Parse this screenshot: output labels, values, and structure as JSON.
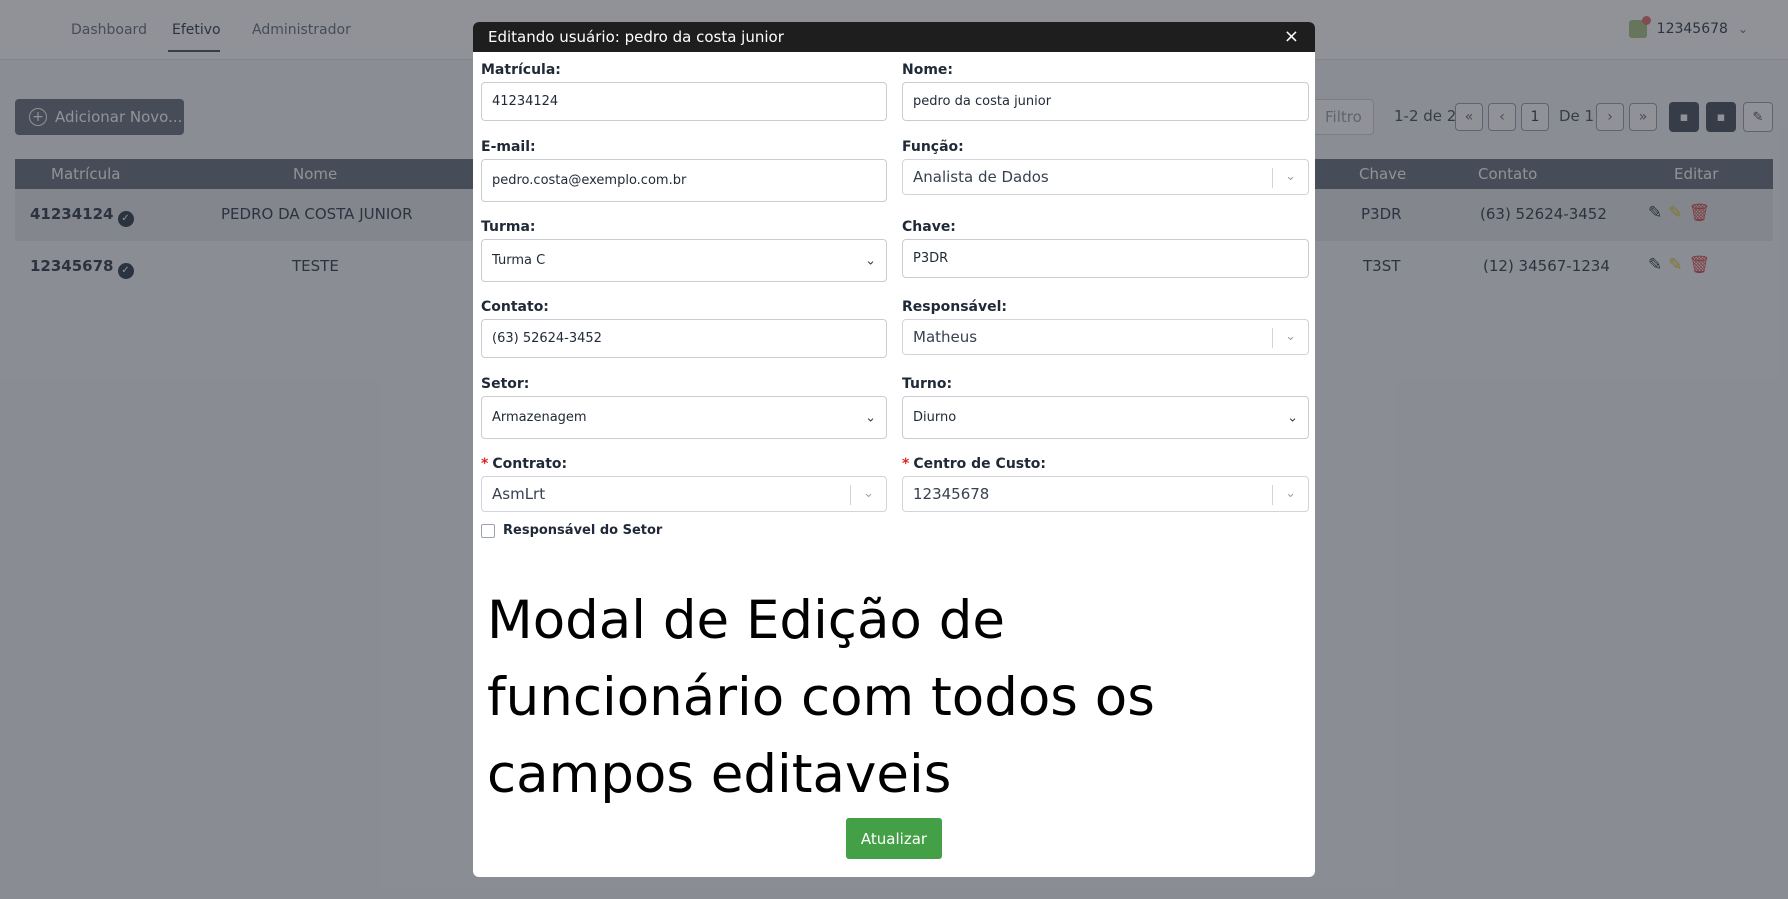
{
  "nav": {
    "items": [
      "Dashboard",
      "Efetivo",
      "Administrador"
    ],
    "user_id": "12345678"
  },
  "toolbar": {
    "add_label": "Adicionar Novo...",
    "filter_label": "Filtro",
    "range_text": "1-2 de 2",
    "current_page": "1",
    "page_of": "De 1"
  },
  "table": {
    "headers": [
      "Matrícula",
      "Nome",
      "Chave",
      "Contato",
      "Editar"
    ],
    "rows": [
      {
        "matricula": "41234124",
        "nome": "PEDRO DA COSTA JUNIOR",
        "chave": "P3DR",
        "contato": "(63) 52624-3452"
      },
      {
        "matricula": "12345678",
        "nome": "TESTE",
        "chave": "T3ST",
        "contato": "(12) 34567-1234"
      }
    ]
  },
  "modal": {
    "title": "Editando usuário: pedro da costa junior",
    "close": "×",
    "fields": {
      "matricula": {
        "label": "Matrícula:",
        "value": "41234124"
      },
      "nome": {
        "label": "Nome:",
        "value": "pedro da costa junior"
      },
      "email": {
        "label": "E-mail:",
        "value": "pedro.costa@exemplo.com.br"
      },
      "funcao": {
        "label": "Função:",
        "value": "Analista de Dados"
      },
      "turma": {
        "label": "Turma:",
        "value": "Turma C"
      },
      "chave": {
        "label": "Chave:",
        "value": "P3DR"
      },
      "contato": {
        "label": "Contato:",
        "value": "(63) 52624-3452"
      },
      "responsavel": {
        "label": "Responsável:",
        "value": "Matheus"
      },
      "setor": {
        "label": "Setor:",
        "value": "Armazenagem"
      },
      "turno": {
        "label": "Turno:",
        "value": "Diurno"
      },
      "contrato": {
        "label": "Contrato:",
        "value": "AsmLrt"
      },
      "centro_custo": {
        "label": "Centro de Custo:",
        "value": "12345678"
      }
    },
    "required_mark": "*",
    "checkbox_label": "Responsável do Setor",
    "caption": "Modal de Edição de funcionário com todos os campos editaveis",
    "submit_label": "Atualizar"
  }
}
